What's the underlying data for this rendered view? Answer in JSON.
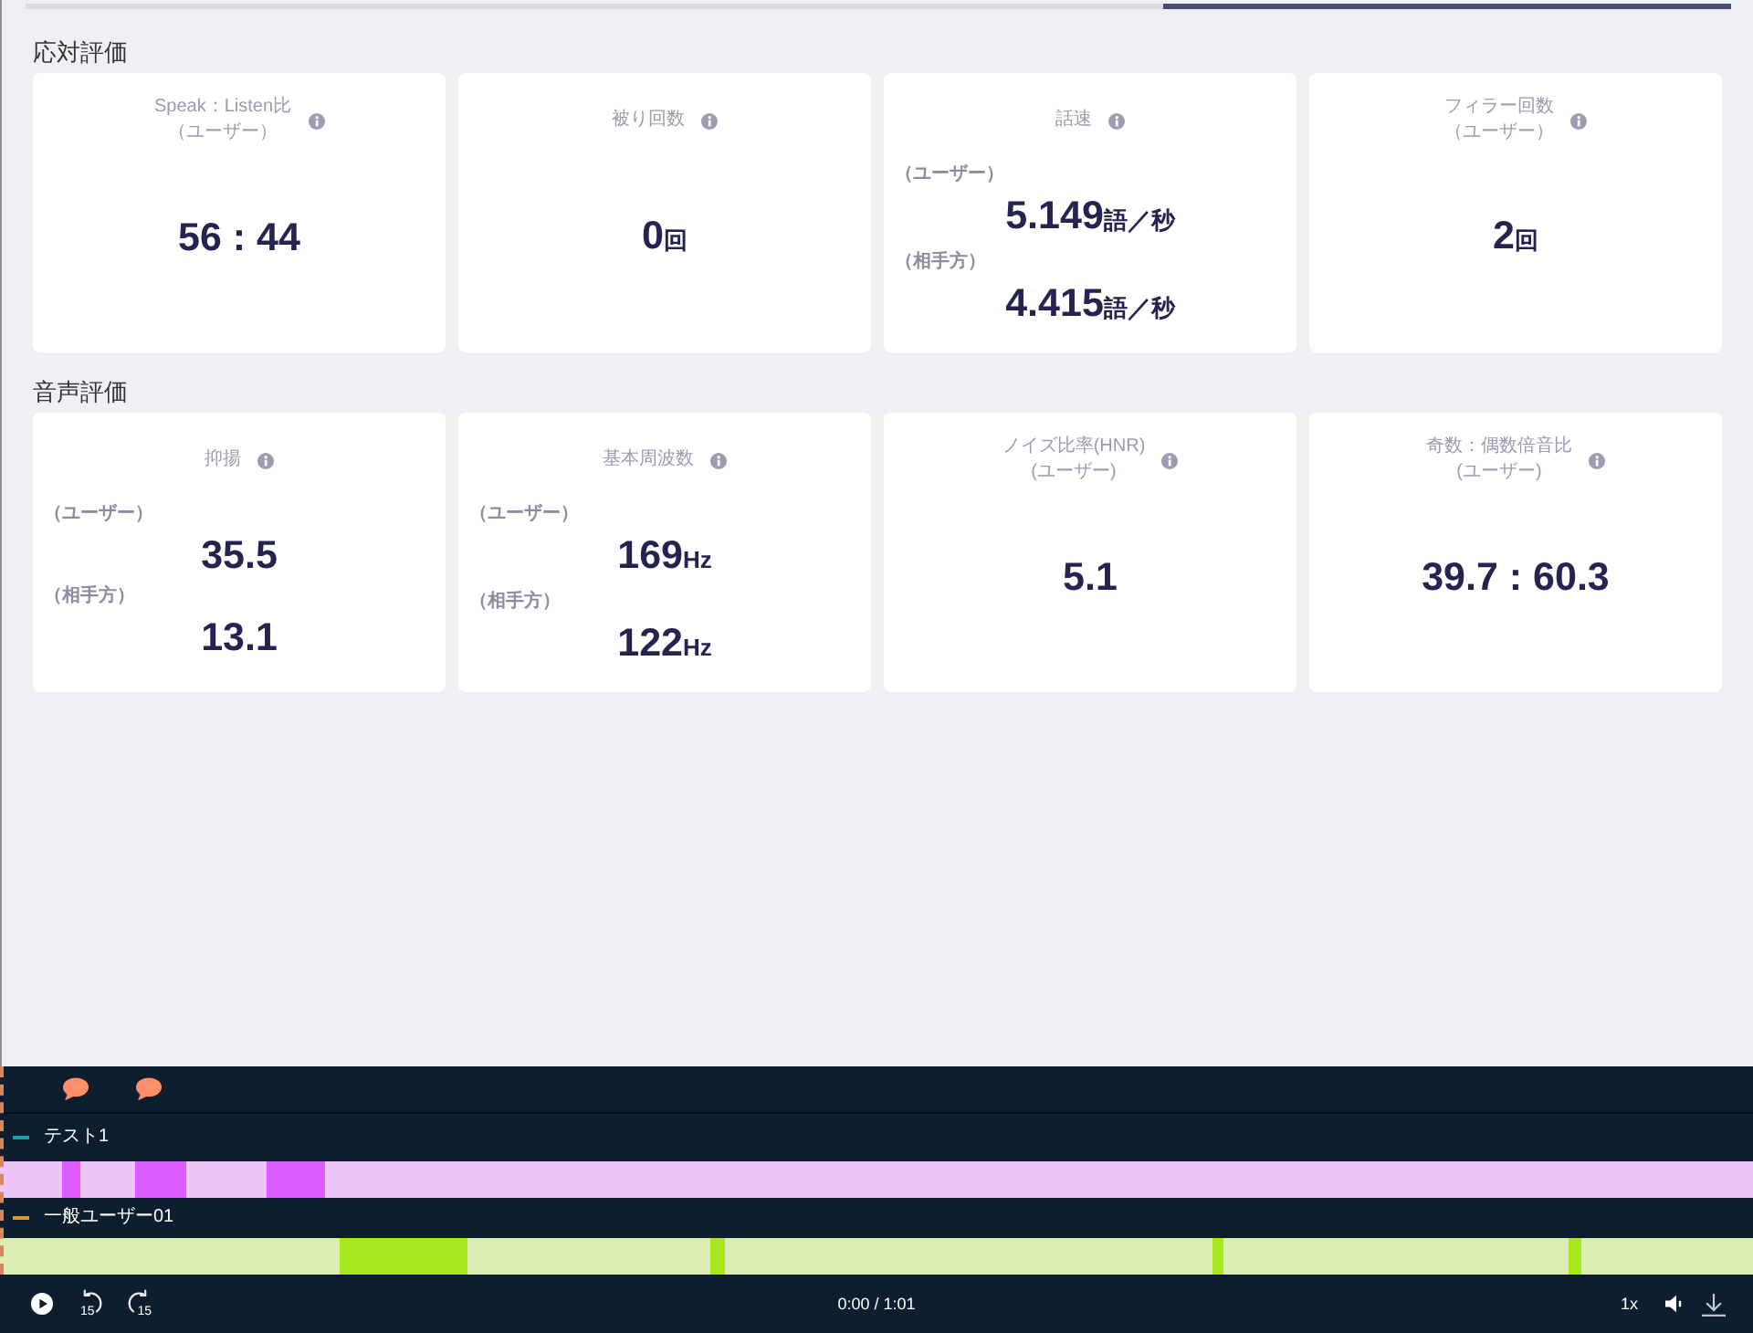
{
  "tabs": [
    {
      "selected": false
    },
    {
      "selected": false
    },
    {
      "selected": true
    }
  ],
  "sections": [
    {
      "title": "応対評価",
      "cards": [
        {
          "kind": "single",
          "title": "Speak：Listen比",
          "subtitle": "（ユーザー）",
          "value": "56 : 44"
        },
        {
          "kind": "single",
          "title": "被り回数",
          "value": "0",
          "unit": "回"
        },
        {
          "kind": "dual",
          "title": "話速",
          "rows": [
            {
              "label": "（ユーザー）",
              "value": "5.149",
              "unit": "語／秒"
            },
            {
              "label": "（相手方）",
              "value": "4.415",
              "unit": "語／秒"
            }
          ]
        },
        {
          "kind": "single",
          "title": "フィラー回数",
          "subtitle": "（ユーザー）",
          "value": "2",
          "unit": "回"
        }
      ]
    },
    {
      "title": "音声評価",
      "cards": [
        {
          "kind": "dual",
          "title": "抑揚",
          "rows": [
            {
              "label": "（ユーザー）",
              "value": "35.5"
            },
            {
              "label": "（相手方）",
              "value": "13.1"
            }
          ]
        },
        {
          "kind": "dual",
          "title": "基本周波数",
          "rows": [
            {
              "label": "（ユーザー）",
              "value": "169",
              "unit": "Hz"
            },
            {
              "label": "（相手方）",
              "value": "122",
              "unit": "Hz"
            }
          ]
        },
        {
          "kind": "single",
          "title": "ノイズ比率(HNR)",
          "subtitle": "(ユーザー)",
          "value": "5.1"
        },
        {
          "kind": "single",
          "title": "奇数：偶数倍音比",
          "subtitle": "(ユーザー)",
          "value": "39.7 : 60.3"
        }
      ]
    }
  ],
  "timeline": {
    "speakers": [
      {
        "name": "テスト1",
        "color": "#1a9fb3",
        "track": {
          "color": "#dd5cff"
        }
      },
      {
        "name": "一般ユーザー01",
        "color": "#e0982a",
        "track": {
          "color": "#a8e620"
        }
      }
    ]
  },
  "player": {
    "playing": false,
    "skip_back": "15",
    "skip_forward": "15",
    "time": "0:00 / 1:01",
    "speed": "1x"
  }
}
